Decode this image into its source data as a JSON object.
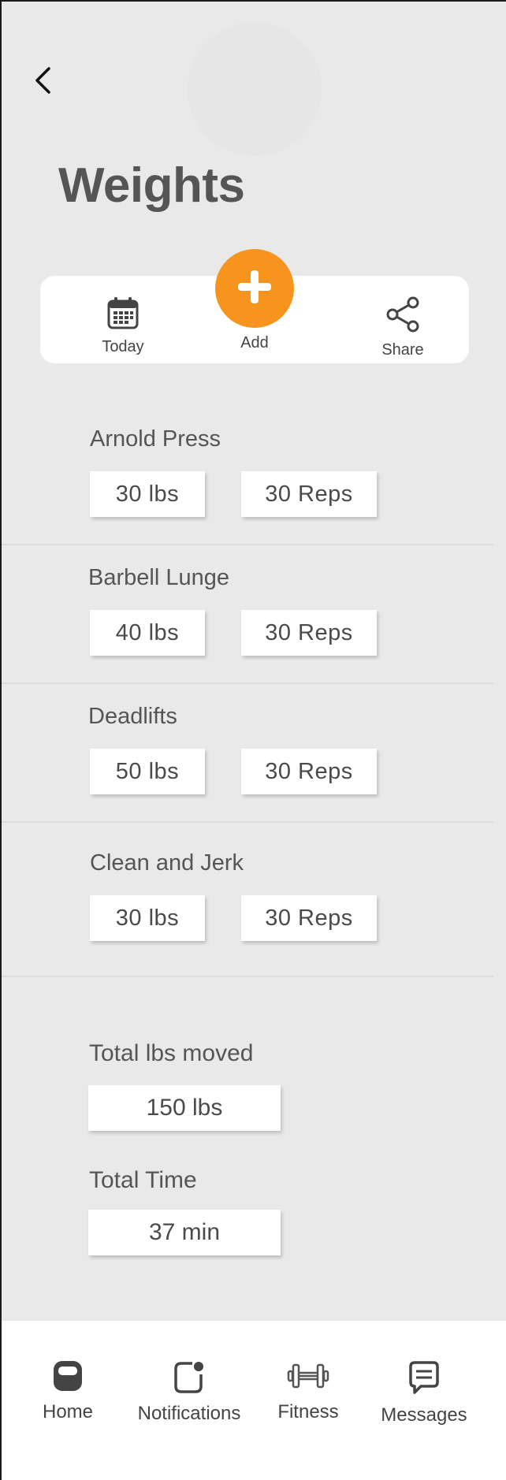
{
  "header": {
    "title": "Weights"
  },
  "toolbar": {
    "today_label": "Today",
    "add_label": "Add",
    "share_label": "Share",
    "accent_color": "#f7941d"
  },
  "exercises": [
    {
      "name": "Arnold Press",
      "weight": "30 lbs",
      "reps": "30 Reps"
    },
    {
      "name": "Barbell Lunge",
      "weight": "40 lbs",
      "reps": "30 Reps"
    },
    {
      "name": "Deadlifts",
      "weight": "50 lbs",
      "reps": "30 Reps"
    },
    {
      "name": "Clean and Jerk",
      "weight": "30 lbs",
      "reps": "30 Reps"
    }
  ],
  "totals": {
    "lbs_label": "Total lbs moved",
    "lbs_value": "150 lbs",
    "time_label": "Total Time",
    "time_value": "37 min"
  },
  "tabbar": {
    "items": [
      {
        "label": "Home",
        "icon": "home-icon"
      },
      {
        "label": "Notifications",
        "icon": "notifications-icon"
      },
      {
        "label": "Fitness",
        "icon": "dumbbell-icon"
      },
      {
        "label": "Messages",
        "icon": "messages-icon"
      }
    ]
  }
}
